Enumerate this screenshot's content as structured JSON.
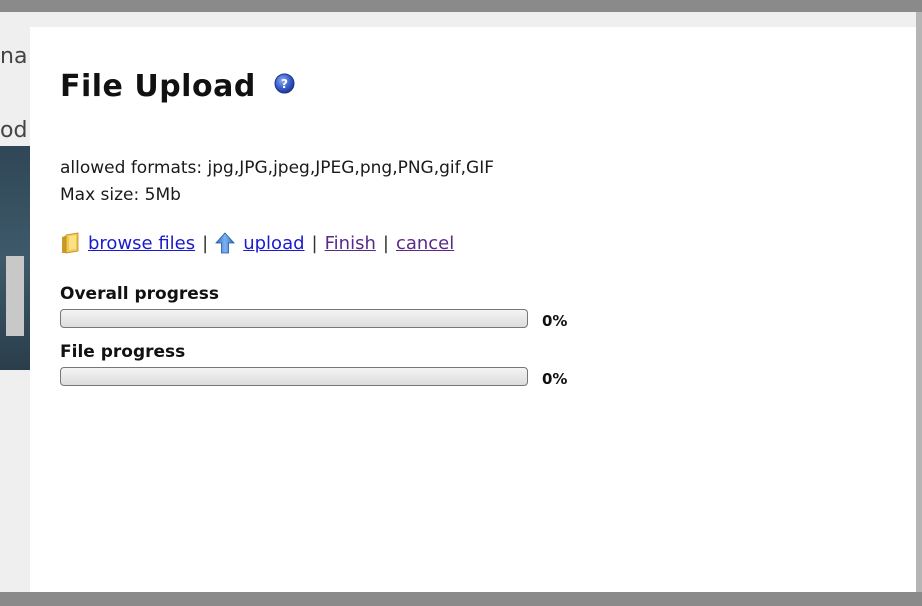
{
  "background": {
    "text_fragment_1": "na",
    "text_fragment_2": "od"
  },
  "dialog": {
    "title": "File Upload",
    "help_icon": "question-circle-icon",
    "allowed_formats": "allowed formats: jpg,JPG,jpeg,JPEG,png,PNG,gif,GIF",
    "max_size": "Max size: 5Mb",
    "actions": {
      "browse_icon": "folder-icon",
      "browse_label": "browse files",
      "upload_icon": "up-arrow-icon",
      "upload_label": "upload",
      "finish_label": "Finish",
      "cancel_label": "cancel",
      "separator": "|"
    },
    "overall_progress": {
      "label": "Overall progress",
      "percent_text": "0%",
      "fraction": 0
    },
    "file_progress": {
      "label": "File progress",
      "percent_text": "0%",
      "fraction": 0
    }
  },
  "colors": {
    "link_blue": "#1a1ad0",
    "link_visited": "#5a2a8a",
    "overlay_gray": "#8e8e8e",
    "help_icon_blue": "#3a5fcd"
  }
}
